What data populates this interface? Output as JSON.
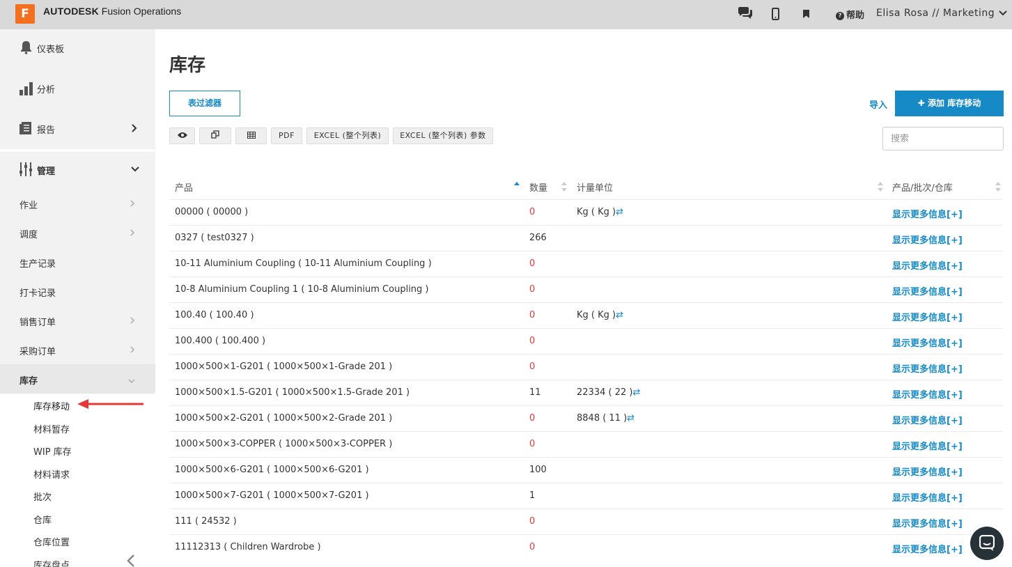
{
  "topbar": {
    "logo_letter": "F",
    "brand_bold": "AUTODESK",
    "brand_rest": "Fusion Operations",
    "help": "帮助",
    "user": "Elisa Rosa // Marketing",
    "icons": [
      "chat-icon",
      "mobile-icon",
      "bookmark-icon",
      "help-icon",
      "chevron-down-icon"
    ]
  },
  "sidebar": {
    "top": [
      {
        "label": "仪表板",
        "icon": "bell-icon"
      },
      {
        "label": "分析",
        "icon": "bar-chart-icon"
      },
      {
        "label": "报告",
        "icon": "report-icon"
      },
      {
        "label": "管理",
        "icon": "sliders-icon"
      }
    ],
    "sub": [
      {
        "label": "作业"
      },
      {
        "label": "调度"
      },
      {
        "label": "生产记录"
      },
      {
        "label": "打卡记录"
      },
      {
        "label": "销售订单"
      },
      {
        "label": "采购订单"
      },
      {
        "label": "库存"
      }
    ],
    "leaves": [
      "库存移动",
      "材料暂存",
      "WIP 库存",
      "材料请求",
      "批次",
      "仓库",
      "仓库位置",
      "库存盘点"
    ]
  },
  "main": {
    "title": "库存",
    "filter_button": "表过滤器",
    "import": "导入",
    "add_button": "添加 库存移动",
    "toolbar": [
      "PDF",
      "EXCEL (整个列表)",
      "EXCEL (整个列表) 参数"
    ],
    "search_placeholder": "搜索"
  },
  "table": {
    "headers": [
      "产品",
      "数量",
      "计量单位",
      "产品/批次/仓库"
    ],
    "more_label": "显示更多信息[+]",
    "rows": [
      {
        "product": "00000 ( 00000 )",
        "qty": "0",
        "unit": "Kg ( Kg )"
      },
      {
        "product": "0327 ( test0327 )",
        "qty": "266",
        "unit": ""
      },
      {
        "product": "10-11 Aluminium Coupling ( 10-11 Aluminium Coupling )",
        "qty": "0",
        "unit": ""
      },
      {
        "product": "10-8 Aluminium Coupling 1 ( 10-8 Aluminium Coupling )",
        "qty": "0",
        "unit": ""
      },
      {
        "product": "100.40 ( 100.40 )",
        "qty": "0",
        "unit": "Kg ( Kg )"
      },
      {
        "product": "100.400 ( 100.400 )",
        "qty": "0",
        "unit": ""
      },
      {
        "product": "1000×500×1-G201 ( 1000×500×1-Grade 201 )",
        "qty": "0",
        "unit": ""
      },
      {
        "product": "1000×500×1.5-G201 ( 1000×500×1.5-Grade 201 )",
        "qty": "11",
        "unit": "22334 ( 22 )"
      },
      {
        "product": "1000×500×2-G201 ( 1000×500×2-Grade 201 )",
        "qty": "0",
        "unit": "8848 ( 11 )"
      },
      {
        "product": "1000×500×3-COPPER ( 1000×500×3-COPPER )",
        "qty": "0",
        "unit": ""
      },
      {
        "product": "1000×500×6-G201 ( 1000×500×6-G201 )",
        "qty": "100",
        "unit": ""
      },
      {
        "product": "1000×500×7-G201 ( 1000×500×7-G201 )",
        "qty": "1",
        "unit": ""
      },
      {
        "product": "111 ( 24532 )",
        "qty": "0",
        "unit": ""
      },
      {
        "product": "11112313 ( Children Wardrobe )",
        "qty": "0",
        "unit": ""
      }
    ]
  },
  "colors": {
    "accent": "#1689c7",
    "zero_qty": "#e53935",
    "arrow": "#e53935",
    "brand": "#f37021"
  }
}
